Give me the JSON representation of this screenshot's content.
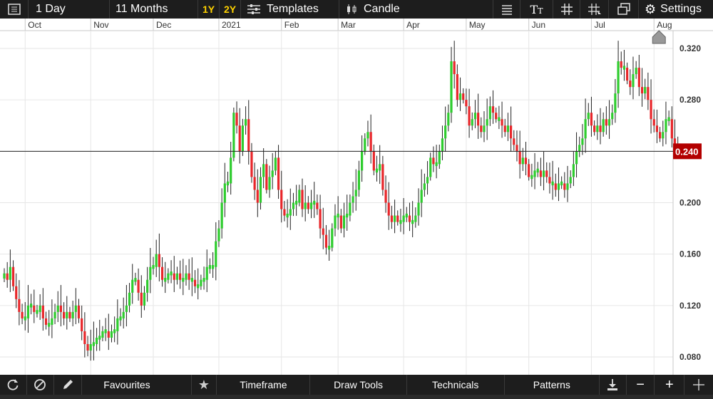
{
  "toolbar": {
    "interval": "1 Day",
    "period": "11 Months",
    "range_1y": "1Y",
    "range_2y": "2Y",
    "templates": "Templates",
    "chart_type": "Candle",
    "settings": "Settings"
  },
  "bottom": {
    "favourites": "Favourites",
    "timeframe": "Timeframe",
    "draw_tools": "Draw Tools",
    "technicals": "Technicals",
    "patterns": "Patterns"
  },
  "colors": {
    "up": "#2ecc2e",
    "down": "#e8262a",
    "price_label": "#b30000",
    "toolbar": "#1d1d1d"
  },
  "chart_data": {
    "type": "candlestick",
    "ylim": [
      0.07,
      0.33
    ],
    "yticks": [
      0.08,
      0.12,
      0.16,
      0.2,
      0.24,
      0.28,
      0.32
    ],
    "ytick_labels": [
      "0.080",
      "0.120",
      "0.160",
      "0.200",
      "0.240",
      "0.280",
      "0.320"
    ],
    "months": [
      {
        "label": "Oct",
        "x_day": 7
      },
      {
        "label": "Nov",
        "x_day": 29
      },
      {
        "label": "Dec",
        "x_day": 50
      },
      {
        "label": "2021",
        "x_day": 72
      },
      {
        "label": "Feb",
        "x_day": 93
      },
      {
        "label": "Mar",
        "x_day": 112
      },
      {
        "label": "Apr",
        "x_day": 134
      },
      {
        "label": "May",
        "x_day": 155
      },
      {
        "label": "Jun",
        "x_day": 176
      },
      {
        "label": "Jul",
        "x_day": 197
      },
      {
        "label": "Aug",
        "x_day": 218
      }
    ],
    "current_price": 0.24,
    "current_price_label": "0.240",
    "closes": [
      0.145,
      0.14,
      0.15,
      0.135,
      0.125,
      0.115,
      0.11,
      0.11,
      0.12,
      0.12,
      0.115,
      0.115,
      0.12,
      0.11,
      0.105,
      0.105,
      0.11,
      0.115,
      0.12,
      0.115,
      0.11,
      0.115,
      0.11,
      0.115,
      0.12,
      0.11,
      0.1,
      0.09,
      0.085,
      0.09,
      0.09,
      0.095,
      0.095,
      0.1,
      0.1,
      0.095,
      0.1,
      0.1,
      0.11,
      0.11,
      0.115,
      0.12,
      0.13,
      0.14,
      0.14,
      0.13,
      0.12,
      0.13,
      0.14,
      0.15,
      0.15,
      0.16,
      0.15,
      0.14,
      0.14,
      0.145,
      0.145,
      0.14,
      0.145,
      0.14,
      0.14,
      0.145,
      0.14,
      0.14,
      0.135,
      0.135,
      0.14,
      0.14,
      0.15,
      0.15,
      0.15,
      0.17,
      0.18,
      0.2,
      0.215,
      0.215,
      0.235,
      0.27,
      0.26,
      0.24,
      0.26,
      0.265,
      0.24,
      0.22,
      0.21,
      0.2,
      0.22,
      0.23,
      0.21,
      0.22,
      0.225,
      0.235,
      0.21,
      0.195,
      0.19,
      0.19,
      0.195,
      0.2,
      0.2,
      0.21,
      0.195,
      0.2,
      0.195,
      0.2,
      0.2,
      0.195,
      0.18,
      0.175,
      0.165,
      0.165,
      0.18,
      0.19,
      0.19,
      0.18,
      0.19,
      0.19,
      0.2,
      0.205,
      0.21,
      0.225,
      0.24,
      0.25,
      0.255,
      0.24,
      0.225,
      0.225,
      0.23,
      0.21,
      0.2,
      0.19,
      0.185,
      0.19,
      0.185,
      0.185,
      0.19,
      0.19,
      0.185,
      0.185,
      0.19,
      0.2,
      0.21,
      0.215,
      0.22,
      0.235,
      0.23,
      0.23,
      0.24,
      0.25,
      0.26,
      0.27,
      0.31,
      0.3,
      0.28,
      0.285,
      0.28,
      0.275,
      0.26,
      0.265,
      0.27,
      0.26,
      0.255,
      0.26,
      0.265,
      0.275,
      0.27,
      0.265,
      0.265,
      0.26,
      0.255,
      0.26,
      0.25,
      0.245,
      0.24,
      0.23,
      0.235,
      0.23,
      0.22,
      0.22,
      0.225,
      0.225,
      0.22,
      0.225,
      0.22,
      0.215,
      0.215,
      0.21,
      0.215,
      0.215,
      0.21,
      0.215,
      0.22,
      0.23,
      0.24,
      0.245,
      0.25,
      0.265,
      0.27,
      0.26,
      0.255,
      0.26,
      0.255,
      0.265,
      0.26,
      0.265,
      0.27,
      0.285,
      0.31,
      0.305,
      0.305,
      0.295,
      0.29,
      0.3,
      0.305,
      0.29,
      0.285,
      0.29,
      0.28,
      0.265,
      0.26,
      0.255,
      0.25,
      0.255,
      0.265,
      0.265,
      0.25,
      0.245,
      0.24
    ]
  }
}
